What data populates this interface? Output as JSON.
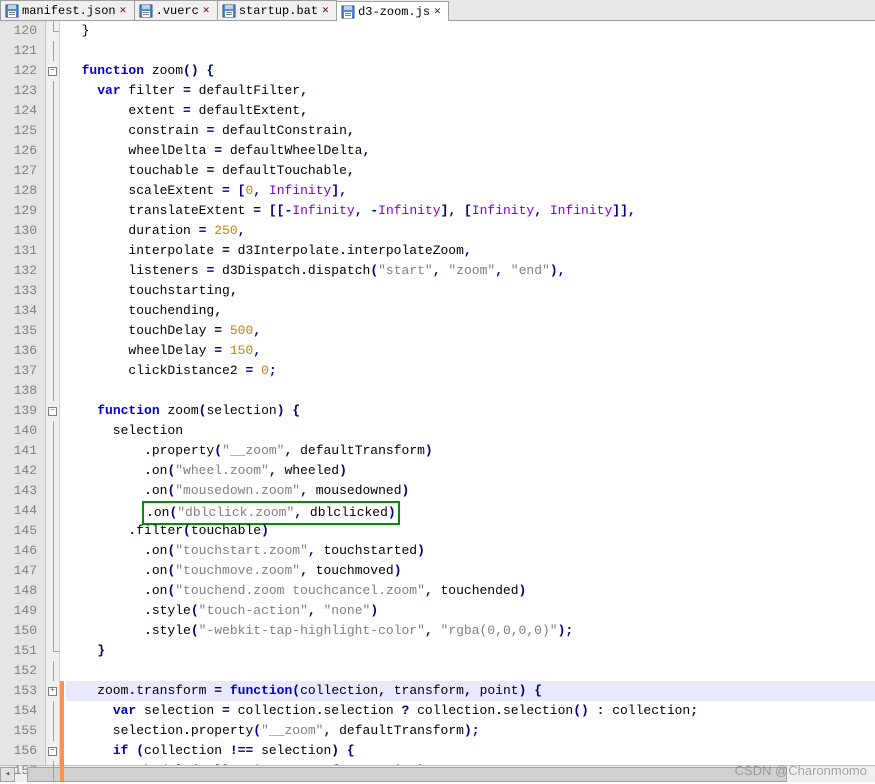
{
  "tabs": [
    {
      "label": "manifest.json",
      "active": false,
      "modified": false
    },
    {
      "label": ".vuerc",
      "active": false,
      "modified": false
    },
    {
      "label": "startup.bat",
      "active": false,
      "modified": false
    },
    {
      "label": "d3-zoom.js",
      "active": true,
      "modified": true
    }
  ],
  "gutter_start": 120,
  "gutter_end": 157,
  "fold_markers": {
    "120": "corner",
    "122": "minus",
    "139": "minus",
    "151": "corner",
    "153": "plus",
    "156": "minus"
  },
  "change_marker_rows": [
    153,
    154,
    155,
    156,
    157
  ],
  "highlighted_row": 153,
  "boxed_row": 144,
  "code": {
    "120": [
      [
        "id",
        "  }"
      ]
    ],
    "121": [],
    "122": [
      [
        "id",
        "  "
      ],
      [
        "kw",
        "function"
      ],
      [
        "id",
        " zoom"
      ],
      [
        "op",
        "()"
      ],
      [
        "id",
        " "
      ],
      [
        "op",
        "{"
      ]
    ],
    "123": [
      [
        "id",
        "    "
      ],
      [
        "kw",
        "var"
      ],
      [
        "id",
        " filter "
      ],
      [
        "op",
        "="
      ],
      [
        "id",
        " defaultFilter"
      ],
      [
        "op",
        ","
      ]
    ],
    "124": [
      [
        "id",
        "        extent "
      ],
      [
        "op",
        "="
      ],
      [
        "id",
        " defaultExtent"
      ],
      [
        "op",
        ","
      ]
    ],
    "125": [
      [
        "id",
        "        constrain "
      ],
      [
        "op",
        "="
      ],
      [
        "id",
        " defaultConstrain"
      ],
      [
        "op",
        ","
      ]
    ],
    "126": [
      [
        "id",
        "        wheelDelta "
      ],
      [
        "op",
        "="
      ],
      [
        "id",
        " defaultWheelDelta"
      ],
      [
        "op",
        ","
      ]
    ],
    "127": [
      [
        "id",
        "        touchable "
      ],
      [
        "op",
        "="
      ],
      [
        "id",
        " defaultTouchable"
      ],
      [
        "op",
        ","
      ]
    ],
    "128": [
      [
        "id",
        "        scaleExtent "
      ],
      [
        "op",
        "="
      ],
      [
        "id",
        " "
      ],
      [
        "op",
        "["
      ],
      [
        "num",
        "0"
      ],
      [
        "op",
        ","
      ],
      [
        "id",
        " "
      ],
      [
        "pur",
        "Infinity"
      ],
      [
        "op",
        "],"
      ]
    ],
    "129": [
      [
        "id",
        "        translateExtent "
      ],
      [
        "op",
        "="
      ],
      [
        "id",
        " "
      ],
      [
        "op",
        "[["
      ],
      [
        "op",
        "-"
      ],
      [
        "pur",
        "Infinity"
      ],
      [
        "op",
        ","
      ],
      [
        "id",
        " "
      ],
      [
        "op",
        "-"
      ],
      [
        "pur",
        "Infinity"
      ],
      [
        "op",
        "],"
      ],
      [
        "id",
        " "
      ],
      [
        "op",
        "["
      ],
      [
        "pur",
        "Infinity"
      ],
      [
        "op",
        ","
      ],
      [
        "id",
        " "
      ],
      [
        "pur",
        "Infinity"
      ],
      [
        "op",
        "]],"
      ]
    ],
    "130": [
      [
        "id",
        "        duration "
      ],
      [
        "op",
        "="
      ],
      [
        "id",
        " "
      ],
      [
        "num",
        "250"
      ],
      [
        "op",
        ","
      ]
    ],
    "131": [
      [
        "id",
        "        interpolate "
      ],
      [
        "op",
        "="
      ],
      [
        "id",
        " d3Interpolate"
      ],
      [
        "op",
        "."
      ],
      [
        "id",
        "interpolateZoom"
      ],
      [
        "op",
        ","
      ]
    ],
    "132": [
      [
        "id",
        "        listeners "
      ],
      [
        "op",
        "="
      ],
      [
        "id",
        " d3Dispatch"
      ],
      [
        "op",
        "."
      ],
      [
        "id",
        "dispatch"
      ],
      [
        "op",
        "("
      ],
      [
        "str",
        "\"start\""
      ],
      [
        "op",
        ","
      ],
      [
        "id",
        " "
      ],
      [
        "str",
        "\"zoom\""
      ],
      [
        "op",
        ","
      ],
      [
        "id",
        " "
      ],
      [
        "str",
        "\"end\""
      ],
      [
        "op",
        "),"
      ]
    ],
    "133": [
      [
        "id",
        "        touchstarting"
      ],
      [
        "op",
        ","
      ]
    ],
    "134": [
      [
        "id",
        "        touchending"
      ],
      [
        "op",
        ","
      ]
    ],
    "135": [
      [
        "id",
        "        touchDelay "
      ],
      [
        "op",
        "="
      ],
      [
        "id",
        " "
      ],
      [
        "num",
        "500"
      ],
      [
        "op",
        ","
      ]
    ],
    "136": [
      [
        "id",
        "        wheelDelay "
      ],
      [
        "op",
        "="
      ],
      [
        "id",
        " "
      ],
      [
        "num",
        "150"
      ],
      [
        "op",
        ","
      ]
    ],
    "137": [
      [
        "id",
        "        clickDistance2 "
      ],
      [
        "op",
        "="
      ],
      [
        "id",
        " "
      ],
      [
        "num",
        "0"
      ],
      [
        "op",
        ";"
      ]
    ],
    "138": [],
    "139": [
      [
        "id",
        "    "
      ],
      [
        "kw",
        "function"
      ],
      [
        "id",
        " zoom"
      ],
      [
        "op",
        "("
      ],
      [
        "id",
        "selection"
      ],
      [
        "op",
        ")"
      ],
      [
        "id",
        " "
      ],
      [
        "op",
        "{"
      ]
    ],
    "140": [
      [
        "id",
        "      selection"
      ]
    ],
    "141": [
      [
        "id",
        "          "
      ],
      [
        "op",
        "."
      ],
      [
        "id",
        "property"
      ],
      [
        "op",
        "("
      ],
      [
        "str",
        "\"__zoom\""
      ],
      [
        "op",
        ","
      ],
      [
        "id",
        " defaultTransform"
      ],
      [
        "op",
        ")"
      ]
    ],
    "142": [
      [
        "id",
        "          "
      ],
      [
        "op",
        "."
      ],
      [
        "id",
        "on"
      ],
      [
        "op",
        "("
      ],
      [
        "str",
        "\"wheel.zoom\""
      ],
      [
        "op",
        ","
      ],
      [
        "id",
        " wheeled"
      ],
      [
        "op",
        ")"
      ]
    ],
    "143": [
      [
        "id",
        "          "
      ],
      [
        "op",
        "."
      ],
      [
        "id",
        "on"
      ],
      [
        "op",
        "("
      ],
      [
        "str",
        "\"mousedown.zoom\""
      ],
      [
        "op",
        ","
      ],
      [
        "id",
        " mousedowned"
      ],
      [
        "op",
        ")"
      ]
    ],
    "144": [
      [
        "id",
        "          "
      ],
      [
        "op",
        "."
      ],
      [
        "id",
        "on"
      ],
      [
        "op",
        "("
      ],
      [
        "str",
        "\"dblclick.zoom\""
      ],
      [
        "op",
        ","
      ],
      [
        "id",
        " dblclicked"
      ],
      [
        "op",
        ")"
      ]
    ],
    "145": [
      [
        "id",
        "        "
      ],
      [
        "op",
        "."
      ],
      [
        "id",
        "filter"
      ],
      [
        "op",
        "("
      ],
      [
        "id",
        "touchable"
      ],
      [
        "op",
        ")"
      ]
    ],
    "146": [
      [
        "id",
        "          "
      ],
      [
        "op",
        "."
      ],
      [
        "id",
        "on"
      ],
      [
        "op",
        "("
      ],
      [
        "str",
        "\"touchstart.zoom\""
      ],
      [
        "op",
        ","
      ],
      [
        "id",
        " touchstarted"
      ],
      [
        "op",
        ")"
      ]
    ],
    "147": [
      [
        "id",
        "          "
      ],
      [
        "op",
        "."
      ],
      [
        "id",
        "on"
      ],
      [
        "op",
        "("
      ],
      [
        "str",
        "\"touchmove.zoom\""
      ],
      [
        "op",
        ","
      ],
      [
        "id",
        " touchmoved"
      ],
      [
        "op",
        ")"
      ]
    ],
    "148": [
      [
        "id",
        "          "
      ],
      [
        "op",
        "."
      ],
      [
        "id",
        "on"
      ],
      [
        "op",
        "("
      ],
      [
        "str",
        "\"touchend.zoom touchcancel.zoom\""
      ],
      [
        "op",
        ","
      ],
      [
        "id",
        " touchended"
      ],
      [
        "op",
        ")"
      ]
    ],
    "149": [
      [
        "id",
        "          "
      ],
      [
        "op",
        "."
      ],
      [
        "id",
        "style"
      ],
      [
        "op",
        "("
      ],
      [
        "str",
        "\"touch-action\""
      ],
      [
        "op",
        ","
      ],
      [
        "id",
        " "
      ],
      [
        "str",
        "\"none\""
      ],
      [
        "op",
        ")"
      ]
    ],
    "150": [
      [
        "id",
        "          "
      ],
      [
        "op",
        "."
      ],
      [
        "id",
        "style"
      ],
      [
        "op",
        "("
      ],
      [
        "str",
        "\"-webkit-tap-highlight-color\""
      ],
      [
        "op",
        ","
      ],
      [
        "id",
        " "
      ],
      [
        "str",
        "\"rgba(0,0,0,0)\""
      ],
      [
        "op",
        ");"
      ]
    ],
    "151": [
      [
        "id",
        "    "
      ],
      [
        "op",
        "}"
      ]
    ],
    "152": [],
    "153": [
      [
        "id",
        "    zoom"
      ],
      [
        "op",
        "."
      ],
      [
        "id",
        "transform "
      ],
      [
        "op",
        "="
      ],
      [
        "id",
        " "
      ],
      [
        "kw",
        "function"
      ],
      [
        "op",
        "("
      ],
      [
        "id",
        "collection"
      ],
      [
        "op",
        ","
      ],
      [
        "id",
        " transform"
      ],
      [
        "op",
        ","
      ],
      [
        "id",
        " point"
      ],
      [
        "op",
        ")"
      ],
      [
        "id",
        " "
      ],
      [
        "op",
        "{"
      ]
    ],
    "154": [
      [
        "id",
        "      "
      ],
      [
        "kw",
        "var"
      ],
      [
        "id",
        " selection "
      ],
      [
        "op",
        "="
      ],
      [
        "id",
        " collection"
      ],
      [
        "op",
        "."
      ],
      [
        "id",
        "selection "
      ],
      [
        "op",
        "?"
      ],
      [
        "id",
        " collection"
      ],
      [
        "op",
        "."
      ],
      [
        "id",
        "selection"
      ],
      [
        "op",
        "()"
      ],
      [
        "id",
        " "
      ],
      [
        "op",
        ":"
      ],
      [
        "id",
        " collection"
      ],
      [
        "op",
        ";"
      ]
    ],
    "155": [
      [
        "id",
        "      selection"
      ],
      [
        "op",
        "."
      ],
      [
        "id",
        "property"
      ],
      [
        "op",
        "("
      ],
      [
        "str",
        "\"__zoom\""
      ],
      [
        "op",
        ","
      ],
      [
        "id",
        " defaultTransform"
      ],
      [
        "op",
        ");"
      ]
    ],
    "156": [
      [
        "id",
        "      "
      ],
      [
        "kw",
        "if"
      ],
      [
        "id",
        " "
      ],
      [
        "op",
        "("
      ],
      [
        "id",
        "collection "
      ],
      [
        "op",
        "!=="
      ],
      [
        "id",
        " selection"
      ],
      [
        "op",
        ")"
      ],
      [
        "id",
        " "
      ],
      [
        "op",
        "{"
      ]
    ],
    "157": [
      [
        "id",
        "        schedule"
      ],
      [
        "op",
        "("
      ],
      [
        "id",
        "collection"
      ],
      [
        "op",
        ","
      ],
      [
        "id",
        " transform"
      ],
      [
        "op",
        ","
      ],
      [
        "id",
        " point"
      ],
      [
        "op",
        ");"
      ]
    ]
  },
  "watermark": "CSDN @Charonmomo"
}
